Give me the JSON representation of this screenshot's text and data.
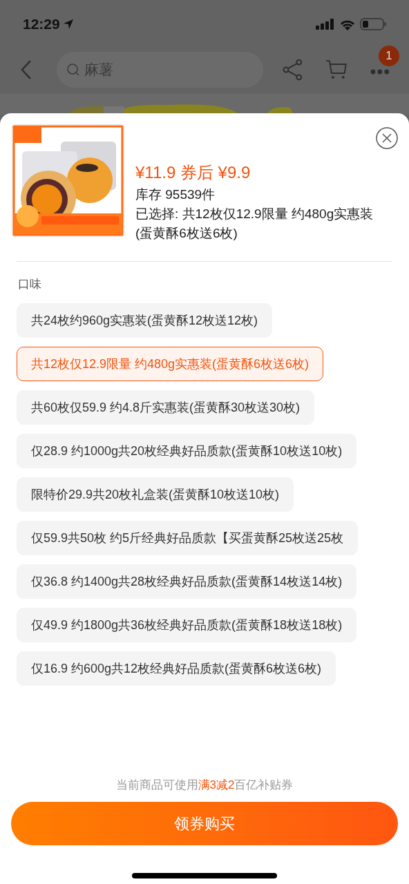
{
  "status_bar": {
    "time": "12:29"
  },
  "nav": {
    "search": {
      "value": "麻薯"
    },
    "more_badge": "1"
  },
  "product": {
    "price": "¥11.9 券后 ¥9.9",
    "stock": "库存 95539件",
    "selection": "已选择: 共12枚仅12.9限量 约480g实惠装(蛋黄酥6枚送6枚)"
  },
  "section_title": "口味",
  "options": [
    {
      "label": "共24枚约960g实惠装(蛋黄酥12枚送12枚)",
      "selected": false
    },
    {
      "label": "共12枚仅12.9限量 约480g实惠装(蛋黄酥6枚送6枚)",
      "selected": true
    },
    {
      "label": "共60枚仅59.9 约4.8斤实惠装(蛋黄酥30枚送30枚)",
      "selected": false
    },
    {
      "label": "仅28.9 约1000g共20枚经典好品质款(蛋黄酥10枚送10枚)",
      "selected": false
    },
    {
      "label": "限特价29.9共20枚礼盒装(蛋黄酥10枚送10枚)",
      "selected": false
    },
    {
      "label": "仅59.9共50枚 约5斤经典好品质款【买蛋黄酥25枚送25枚",
      "selected": false
    },
    {
      "label": "仅36.8 约1400g共28枚经典好品质款(蛋黄酥14枚送14枚)",
      "selected": false
    },
    {
      "label": "仅49.9 约1800g共36枚经典好品质款(蛋黄酥18枚送18枚)",
      "selected": false
    },
    {
      "label": "仅16.9 约600g共12枚经典好品质款(蛋黄酥6枚送6枚)",
      "selected": false
    }
  ],
  "coupon_note": "当前商品可使用**满3减2**百亿补贴券",
  "buy_button": "领券购买"
}
